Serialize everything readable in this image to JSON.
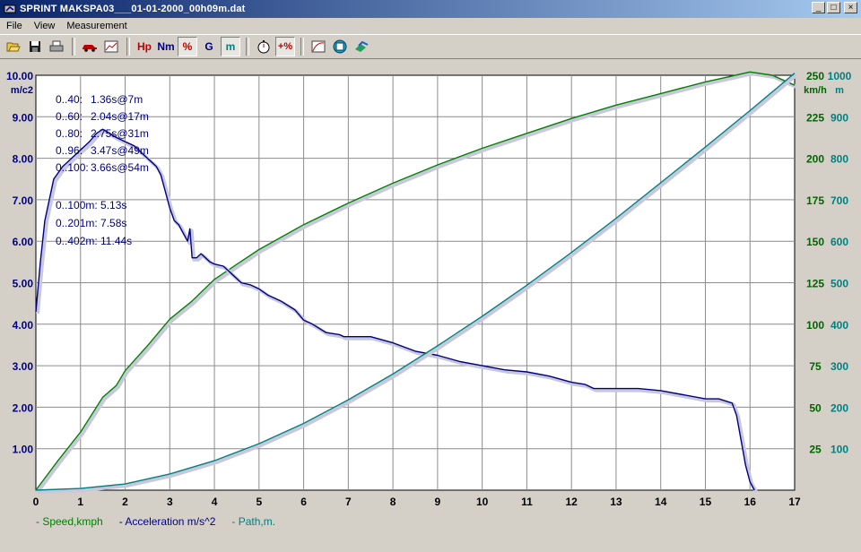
{
  "window": {
    "title": "SPRINT  MAKSPA03___01-01-2000_00h09m.dat",
    "controls": [
      "_",
      "□",
      "×"
    ]
  },
  "menu": [
    "File",
    "View",
    "Measurement"
  ],
  "toolbar": {
    "hp_label": "Hp",
    "nm_label": "Nm",
    "pct_label": "%",
    "g_label": "G",
    "m_label": "m",
    "plus_pct_label": "+%",
    "icons": [
      "open-icon",
      "save-icon",
      "print-icon",
      "car-icon",
      "chart-icon",
      "hp-icon",
      "nm-icon",
      "percent-icon",
      "g-icon",
      "meter-icon",
      "stopwatch-icon",
      "plus-percent-icon",
      "graph-icon",
      "film-icon",
      "export-icon"
    ]
  },
  "annotations": {
    "left_col": [
      "0..40:",
      "0..60:",
      "0..80:",
      "0..96:",
      "0..100:"
    ],
    "right_col": [
      "1.36s@7m",
      "2.04s@17m",
      "2.75s@31m",
      "3.47s@49m",
      "3.66s@54m"
    ],
    "dist": [
      "0..100m: 5.13s",
      "0..201m: 7.58s",
      "0..402m: 11.44s"
    ]
  },
  "legend": [
    {
      "label": "- Speed,kmph",
      "color": "#008000"
    },
    {
      "label": "- Acceleration m/s^2",
      "color": "#000080"
    },
    {
      "label": "- Path,m.",
      "color": "#008080"
    }
  ],
  "chart_data": {
    "type": "line",
    "x_ticks": [
      "0",
      "1",
      "2",
      "3",
      "4",
      "5",
      "6",
      "7",
      "8",
      "9",
      "10",
      "11",
      "12",
      "13",
      "14",
      "15",
      "16",
      "17"
    ],
    "xlim": [
      0,
      17
    ],
    "grid": true,
    "left_axis": {
      "unit": "m/c2",
      "ticks": [
        "1.00",
        "2.00",
        "3.00",
        "4.00",
        "5.00",
        "6.00",
        "7.00",
        "8.00",
        "9.00",
        "10.00"
      ],
      "ylim": [
        0,
        10
      ],
      "color": "#000080"
    },
    "speed_axis": {
      "unit": "km/h",
      "ticks": [
        "25",
        "50",
        "75",
        "100",
        "125",
        "150",
        "175",
        "200",
        "225",
        "250"
      ],
      "ylim": [
        0,
        250
      ],
      "color": "#006400"
    },
    "path_axis": {
      "unit": "m",
      "ticks": [
        "100",
        "200",
        "300",
        "400",
        "500",
        "600",
        "700",
        "800",
        "900",
        "1000"
      ],
      "ylim": [
        0,
        1000
      ],
      "color": "#008080"
    },
    "series": [
      {
        "name": "Speed,kmph",
        "color": "#008000",
        "x": [
          0,
          0.5,
          1,
          1.5,
          1.8,
          2,
          2.5,
          3,
          3.5,
          4,
          4.5,
          5,
          6,
          7,
          8,
          9,
          10,
          11,
          12,
          13,
          14,
          15,
          15.5,
          16,
          16.5,
          17
        ],
        "y": [
          0,
          18,
          35,
          56,
          63,
          72,
          87,
          103,
          114,
          127,
          136,
          145,
          160,
          173,
          185,
          196,
          206,
          215,
          224,
          232,
          239,
          246,
          249,
          252,
          250,
          244
        ]
      },
      {
        "name": "Acceleration m/s^2",
        "color": "#000080",
        "x": [
          0,
          0.1,
          0.2,
          0.4,
          0.6,
          0.8,
          1.0,
          1.2,
          1.36,
          1.5,
          1.8,
          2.0,
          2.2,
          2.4,
          2.6,
          2.7,
          2.8,
          2.9,
          3.0,
          3.1,
          3.2,
          3.3,
          3.4,
          3.45,
          3.5,
          3.6,
          3.7,
          3.8,
          3.9,
          4.0,
          4.2,
          4.4,
          4.6,
          4.8,
          5.0,
          5.2,
          5.5,
          5.8,
          6.0,
          6.2,
          6.5,
          6.8,
          6.9,
          7.0,
          7.5,
          8.0,
          8.5,
          9.0,
          9.5,
          10.0,
          10.5,
          11.0,
          11.5,
          12.0,
          12.3,
          12.5,
          13.0,
          13.5,
          14.0,
          14.5,
          15.0,
          15.3,
          15.6,
          15.7,
          15.8,
          15.9,
          16.0,
          16.1
        ],
        "y": [
          4.3,
          5.5,
          6.5,
          7.5,
          7.8,
          8.0,
          8.2,
          8.4,
          8.6,
          8.7,
          8.5,
          8.4,
          8.3,
          8.1,
          7.9,
          7.8,
          7.6,
          7.2,
          6.8,
          6.5,
          6.4,
          6.2,
          6.0,
          6.3,
          5.6,
          5.6,
          5.7,
          5.6,
          5.5,
          5.45,
          5.4,
          5.2,
          5.0,
          4.95,
          4.85,
          4.7,
          4.55,
          4.35,
          4.1,
          4.0,
          3.8,
          3.75,
          3.7,
          3.7,
          3.7,
          3.55,
          3.35,
          3.25,
          3.1,
          3.0,
          2.9,
          2.85,
          2.75,
          2.6,
          2.55,
          2.45,
          2.45,
          2.45,
          2.4,
          2.3,
          2.2,
          2.2,
          2.1,
          1.8,
          1.2,
          0.6,
          0.2,
          0
        ]
      },
      {
        "name": "Path,m.",
        "color": "#008080",
        "x": [
          0,
          1,
          2,
          3,
          4,
          5,
          6,
          7,
          8,
          9,
          10,
          11,
          12,
          13,
          14,
          15,
          16,
          17
        ],
        "y": [
          0,
          4,
          15,
          39,
          71,
          112,
          161,
          218,
          280,
          348,
          419,
          494,
          573,
          655,
          741,
          827,
          915,
          1005
        ]
      }
    ]
  }
}
